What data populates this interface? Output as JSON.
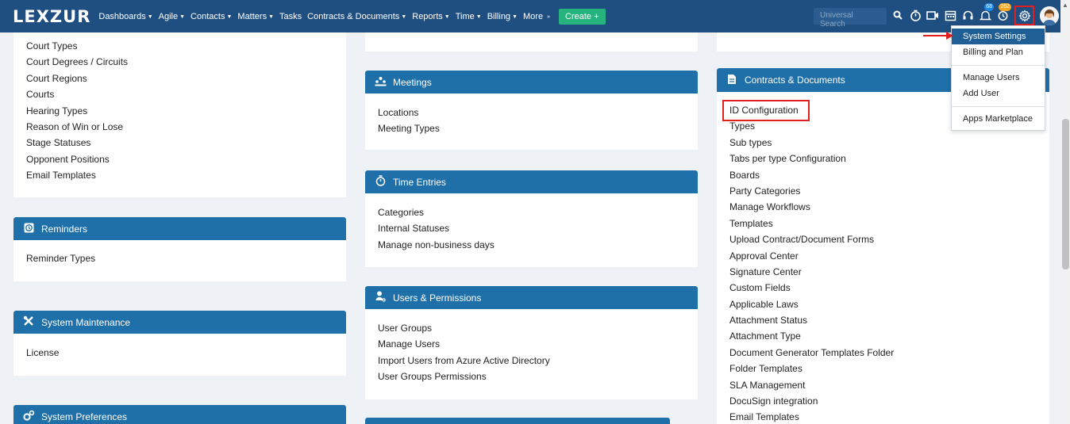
{
  "app": {
    "logo": "LEXZUR"
  },
  "nav": {
    "items": [
      {
        "label": "Dashboards",
        "caret": true
      },
      {
        "label": "Agile",
        "caret": true
      },
      {
        "label": "Contacts",
        "caret": true
      },
      {
        "label": "Matters",
        "caret": true
      },
      {
        "label": "Tasks",
        "caret": false
      },
      {
        "label": "Contracts & Documents",
        "caret": true
      },
      {
        "label": "Reports",
        "caret": true
      },
      {
        "label": "Time",
        "caret": true
      },
      {
        "label": "Billing",
        "caret": true
      },
      {
        "label": "More",
        "caret": false
      }
    ],
    "more_glyph": "»",
    "create_label": "Create +",
    "search_placeholder": "Universal Search",
    "badge_bell": "68",
    "badge_reminder": "262"
  },
  "colors": {
    "navbar": "#1f4f80",
    "panel_header": "#1f6fa8",
    "highlight": "#e02020",
    "create": "#27b37e"
  },
  "left": {
    "top_list": [
      "Court Types",
      "Court Degrees / Circuits",
      "Court Regions",
      "Courts",
      "Hearing Types",
      "Reason of Win or Lose",
      "Stage Statuses",
      "Opponent Positions",
      "Email Templates"
    ],
    "reminders": {
      "title": "Reminders",
      "icon": "clock-history-icon",
      "items": [
        "Reminder Types"
      ]
    },
    "maintenance": {
      "title": "System Maintenance",
      "icon": "tools-icon",
      "items": [
        "License"
      ]
    },
    "preferences": {
      "title": "System Preferences",
      "icon": "gears-icon"
    }
  },
  "middle": {
    "meetings": {
      "title": "Meetings",
      "icon": "people-icon",
      "items": [
        "Locations",
        "Meeting Types"
      ]
    },
    "time_entries": {
      "title": "Time Entries",
      "icon": "stopwatch-icon",
      "items": [
        "Categories",
        "Internal Statuses",
        "Manage non-business days"
      ]
    },
    "users": {
      "title": "Users & Permissions",
      "icon": "user-key-icon",
      "items": [
        "User Groups",
        "Manage Users",
        "Import Users from Azure Active Directory",
        "User Groups Permissions"
      ]
    }
  },
  "right": {
    "contracts": {
      "title": "Contracts & Documents",
      "icon": "document-icon",
      "items": [
        "ID Configuration",
        "Types",
        "Sub types",
        "Tabs per type Configuration",
        "Boards",
        "Party Categories",
        "Manage Workflows",
        "Templates",
        "Upload Contract/Document Forms",
        "Approval Center",
        "Signature Center",
        "Custom Fields",
        "Applicable Laws",
        "Attachment Status",
        "Attachment Type",
        "Document Generator Templates Folder",
        "Folder Templates",
        "SLA Management",
        "DocuSign integration",
        "Email Templates"
      ]
    }
  },
  "dropdown": {
    "items": [
      "System Settings",
      "Billing and Plan",
      "Manage Users",
      "Add User",
      "Apps Marketplace"
    ]
  }
}
